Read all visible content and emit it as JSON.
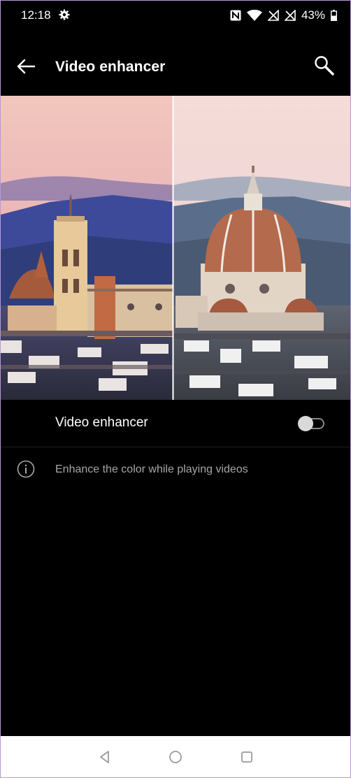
{
  "status_bar": {
    "time": "12:18",
    "battery_percent": "43%",
    "icons": [
      "gear-icon",
      "nfc-icon",
      "wifi-icon",
      "no-signal-icon",
      "no-signal-icon",
      "battery-icon"
    ]
  },
  "toolbar": {
    "title": "Video enhancer",
    "back_icon": "arrow-left-icon",
    "search_icon": "search-icon"
  },
  "preview": {
    "description_icon": "before-after-comparison-image"
  },
  "setting": {
    "label": "Video enhancer",
    "enabled": false
  },
  "info": {
    "text": "Enhance the color while playing videos",
    "icon": "info-icon"
  },
  "nav": {
    "icons": [
      "nav-back-icon",
      "nav-home-icon",
      "nav-recents-icon"
    ]
  },
  "colors": {
    "background": "#000000",
    "secondary_text": "#a6a6a6",
    "navbar": "#ffffff"
  }
}
